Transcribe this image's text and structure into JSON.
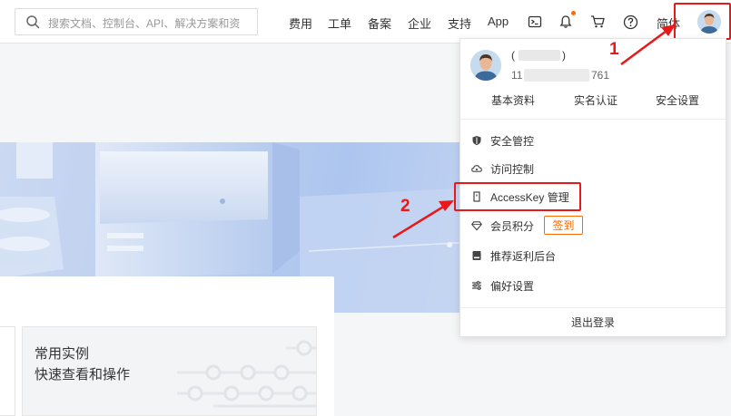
{
  "search": {
    "placeholder": "搜索文档、控制台、API、解决方案和资"
  },
  "nav": {
    "items": [
      "费用",
      "工单",
      "备案",
      "企业",
      "支持",
      "App"
    ],
    "lang": "简体"
  },
  "icons": {
    "search": "search-icon",
    "terminal": "terminal-icon",
    "bell": "bell-icon",
    "cart": "cart-icon",
    "help": "help-icon",
    "avatar": "avatar"
  },
  "colors": {
    "accent": "#ff6a00",
    "annotation": "#e81919",
    "banner": "#b9cdef"
  },
  "dropdown": {
    "user_name_prefix": "(",
    "user_name_suffix": ")",
    "uid_prefix": "11",
    "uid_suffix": "761",
    "quick_links": [
      "基本资料",
      "实名认证",
      "安全设置"
    ],
    "menu": [
      {
        "label": "安全管控",
        "icon": "shield-icon"
      },
      {
        "label": "访问控制",
        "icon": "cloud-icon"
      },
      {
        "label": "AccessKey 管理",
        "icon": "key-icon"
      },
      {
        "label": "会员积分",
        "icon": "diamond-icon"
      },
      {
        "label": "推荐返利后台",
        "icon": "book-icon"
      },
      {
        "label": "偏好设置",
        "icon": "sliders-icon"
      }
    ],
    "sign_in": "签到",
    "logout": "退出登录"
  },
  "card": {
    "title_line1": "常用实例",
    "title_line2": "快速查看和操作"
  },
  "annotations": {
    "step1": "1",
    "step2": "2"
  }
}
